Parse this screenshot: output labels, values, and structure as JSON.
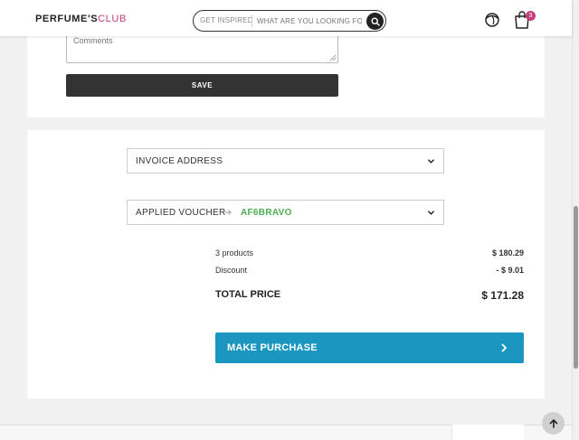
{
  "header": {
    "logo_main": "PERFUME'S",
    "logo_accent": "CLUB",
    "search_inspired": "GET INSPIRED",
    "search_placeholder": "WHAT ARE YOU LOOKING FOR",
    "cart_count": "3"
  },
  "comments": {
    "placeholder": "Comments"
  },
  "save_button": "SAVE",
  "invoice_address": {
    "label": "INVOICE ADDRESS"
  },
  "voucher": {
    "label": "APPLIED VOUCHER",
    "code": "AF6BRAVO"
  },
  "summary": {
    "products_label": "3 products",
    "products_value": "$ 180.29",
    "discount_label": "Discount",
    "discount_value": "- $ 9.01",
    "total_label": "TOTAL PRICE",
    "total_value": "$ 171.28"
  },
  "purchase_button": "MAKE PURCHASE",
  "colors": {
    "brand_accent": "#c4407a",
    "purchase_blue": "#1a96c0",
    "voucher_green": "#4caf50",
    "dark_button": "#333333"
  }
}
